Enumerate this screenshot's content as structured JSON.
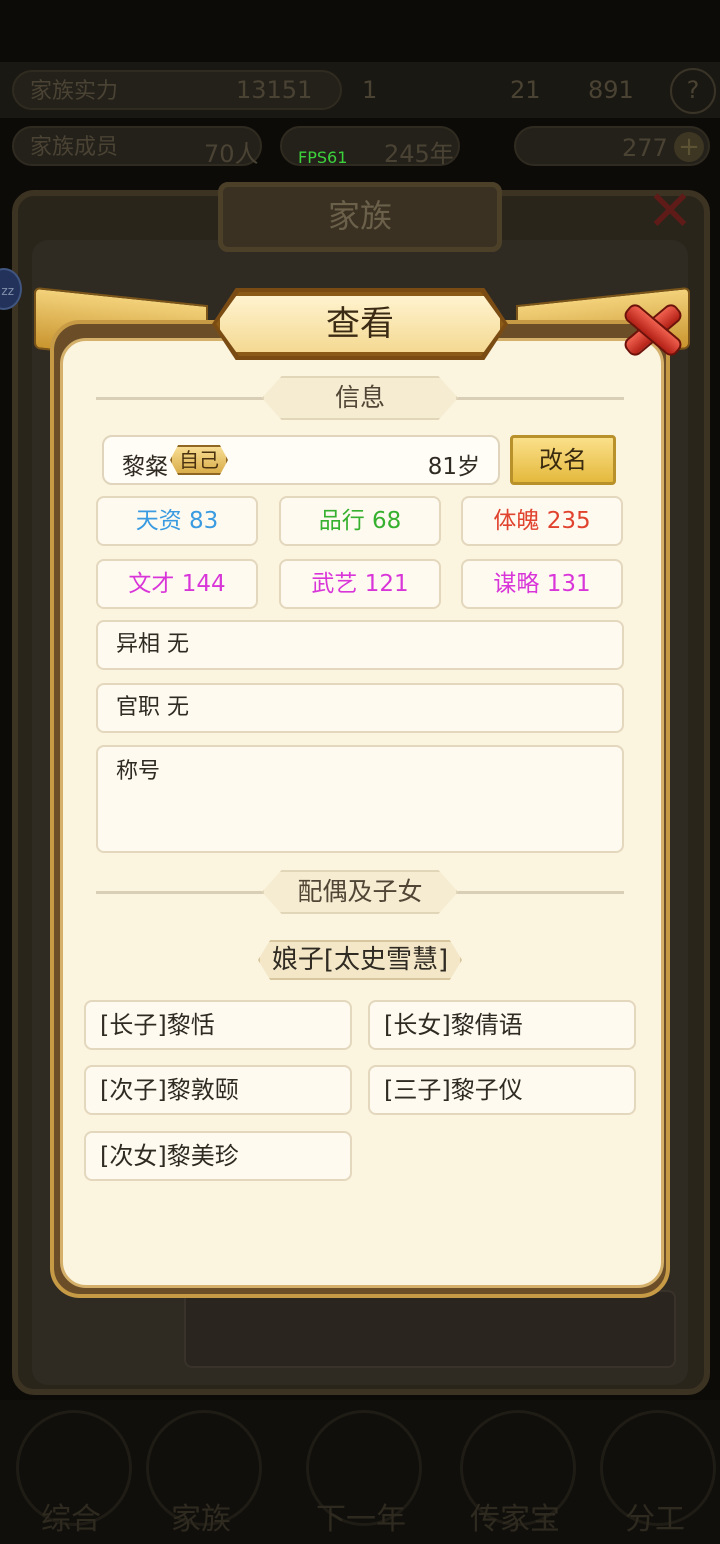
{
  "background": {
    "top_left_chip": "家族实力",
    "top_number": "13151",
    "top_number2": "1",
    "top_right_a": "21",
    "top_right_b": "891",
    "member_chip": "家族成员",
    "member_count": "70人",
    "years": "245年",
    "resource": "277",
    "family_title": "家族",
    "zz_badge": "zz",
    "nav": [
      "综合",
      "家族",
      "下一年",
      "传家宝",
      "分工"
    ]
  },
  "fps": "FPS61",
  "dialog": {
    "title": "查看",
    "info_header": "信息",
    "name": "黎粲",
    "self_tag": "自己",
    "age": "81岁",
    "rename_button": "改名",
    "stats": [
      {
        "label": "天资 83",
        "color": "#3a9be0"
      },
      {
        "label": "品行 68",
        "color": "#36b02f"
      },
      {
        "label": "体魄 235",
        "color": "#e0432e"
      },
      {
        "label": "文才 144",
        "color": "#d936d9"
      },
      {
        "label": "武艺 121",
        "color": "#d936d9"
      },
      {
        "label": "谋略 131",
        "color": "#d936d9"
      }
    ],
    "feature": "异相 无",
    "office": "官职 无",
    "titles_label": "称号",
    "family_header": "配偶及子女",
    "spouse": "娘子[太史雪慧]",
    "children": [
      "[长子]黎恬",
      "[长女]黎倩语",
      "[次子]黎敦颐",
      "[三子]黎子仪",
      "[次女]黎美珍"
    ]
  }
}
